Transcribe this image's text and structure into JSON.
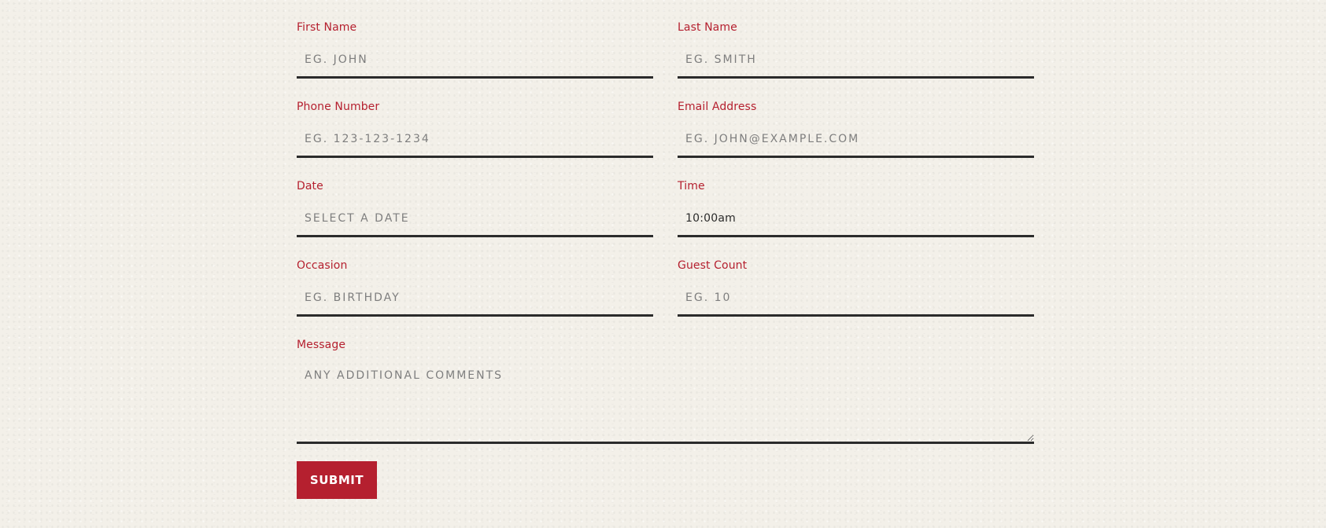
{
  "form": {
    "first_name": {
      "label": "First Name",
      "placeholder": "EG. JOHN"
    },
    "last_name": {
      "label": "Last Name",
      "placeholder": "EG. SMITH"
    },
    "phone": {
      "label": "Phone Number",
      "placeholder": "EG. 123-123-1234"
    },
    "email": {
      "label": "Email Address",
      "placeholder": "EG. JOHN@EXAMPLE.COM"
    },
    "date": {
      "label": "Date",
      "placeholder": "SELECT A DATE"
    },
    "time": {
      "label": "Time",
      "value": "10:00am"
    },
    "occasion": {
      "label": "Occasion",
      "placeholder": "EG. BIRTHDAY"
    },
    "guest_count": {
      "label": "Guest Count",
      "placeholder": "EG. 10"
    },
    "message": {
      "label": "Message",
      "placeholder": "ANY ADDITIONAL COMMENTS"
    },
    "submit_label": "SUBMIT"
  },
  "colors": {
    "accent": "#b5202f",
    "background": "#f3f0e9",
    "underline": "#2b2b2b",
    "placeholder": "#7e7e7e"
  }
}
